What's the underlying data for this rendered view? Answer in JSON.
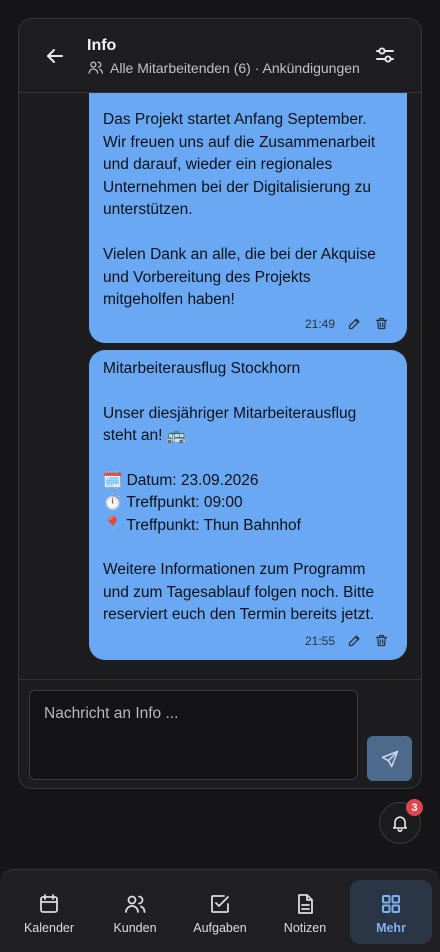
{
  "header": {
    "title": "Info",
    "subtitle": "Alle Mitarbeitenden (6) · Ankündigungen"
  },
  "messages": [
    {
      "text": "Das Projekt startet Anfang September. Wir freuen uns auf die Zusammenarbeit und darauf, wieder ein regionales Unternehmen bei der Digitalisierung zu unterstützen.\n\nVielen Dank an alle, die bei der Akquise und Vorbereitung des Projekts mitgeholfen haben!",
      "time": "21:49"
    },
    {
      "title": "Mitarbeiterausflug Stockhorn",
      "intro": "Unser diesjähriger Mitarbeiterausflug steht an! 🚌",
      "date_line": "Datum: 23.09.2026",
      "time_line": "Treffpunkt: 09:00",
      "place_line": "Treffpunkt: Thun Bahnhof",
      "outro": "Weitere Informationen zum Programm und zum Tagesablauf folgen noch. Bitte reserviert euch den Termin bereits jetzt.",
      "time": "21:55"
    }
  ],
  "composer": {
    "placeholder": "Nachricht an Info ...",
    "value": ""
  },
  "notifications": {
    "count": "3"
  },
  "nav": {
    "items": [
      {
        "label": "Kalender",
        "icon": "calendar-icon"
      },
      {
        "label": "Kunden",
        "icon": "users-icon"
      },
      {
        "label": "Aufgaben",
        "icon": "checkbox-icon"
      },
      {
        "label": "Notizen",
        "icon": "document-icon"
      },
      {
        "label": "Mehr",
        "icon": "grid-icon",
        "active": true
      }
    ]
  },
  "colors": {
    "bubble": "#6aa8f3",
    "accent": "#7fb0ee",
    "badge": "#e0454f"
  }
}
